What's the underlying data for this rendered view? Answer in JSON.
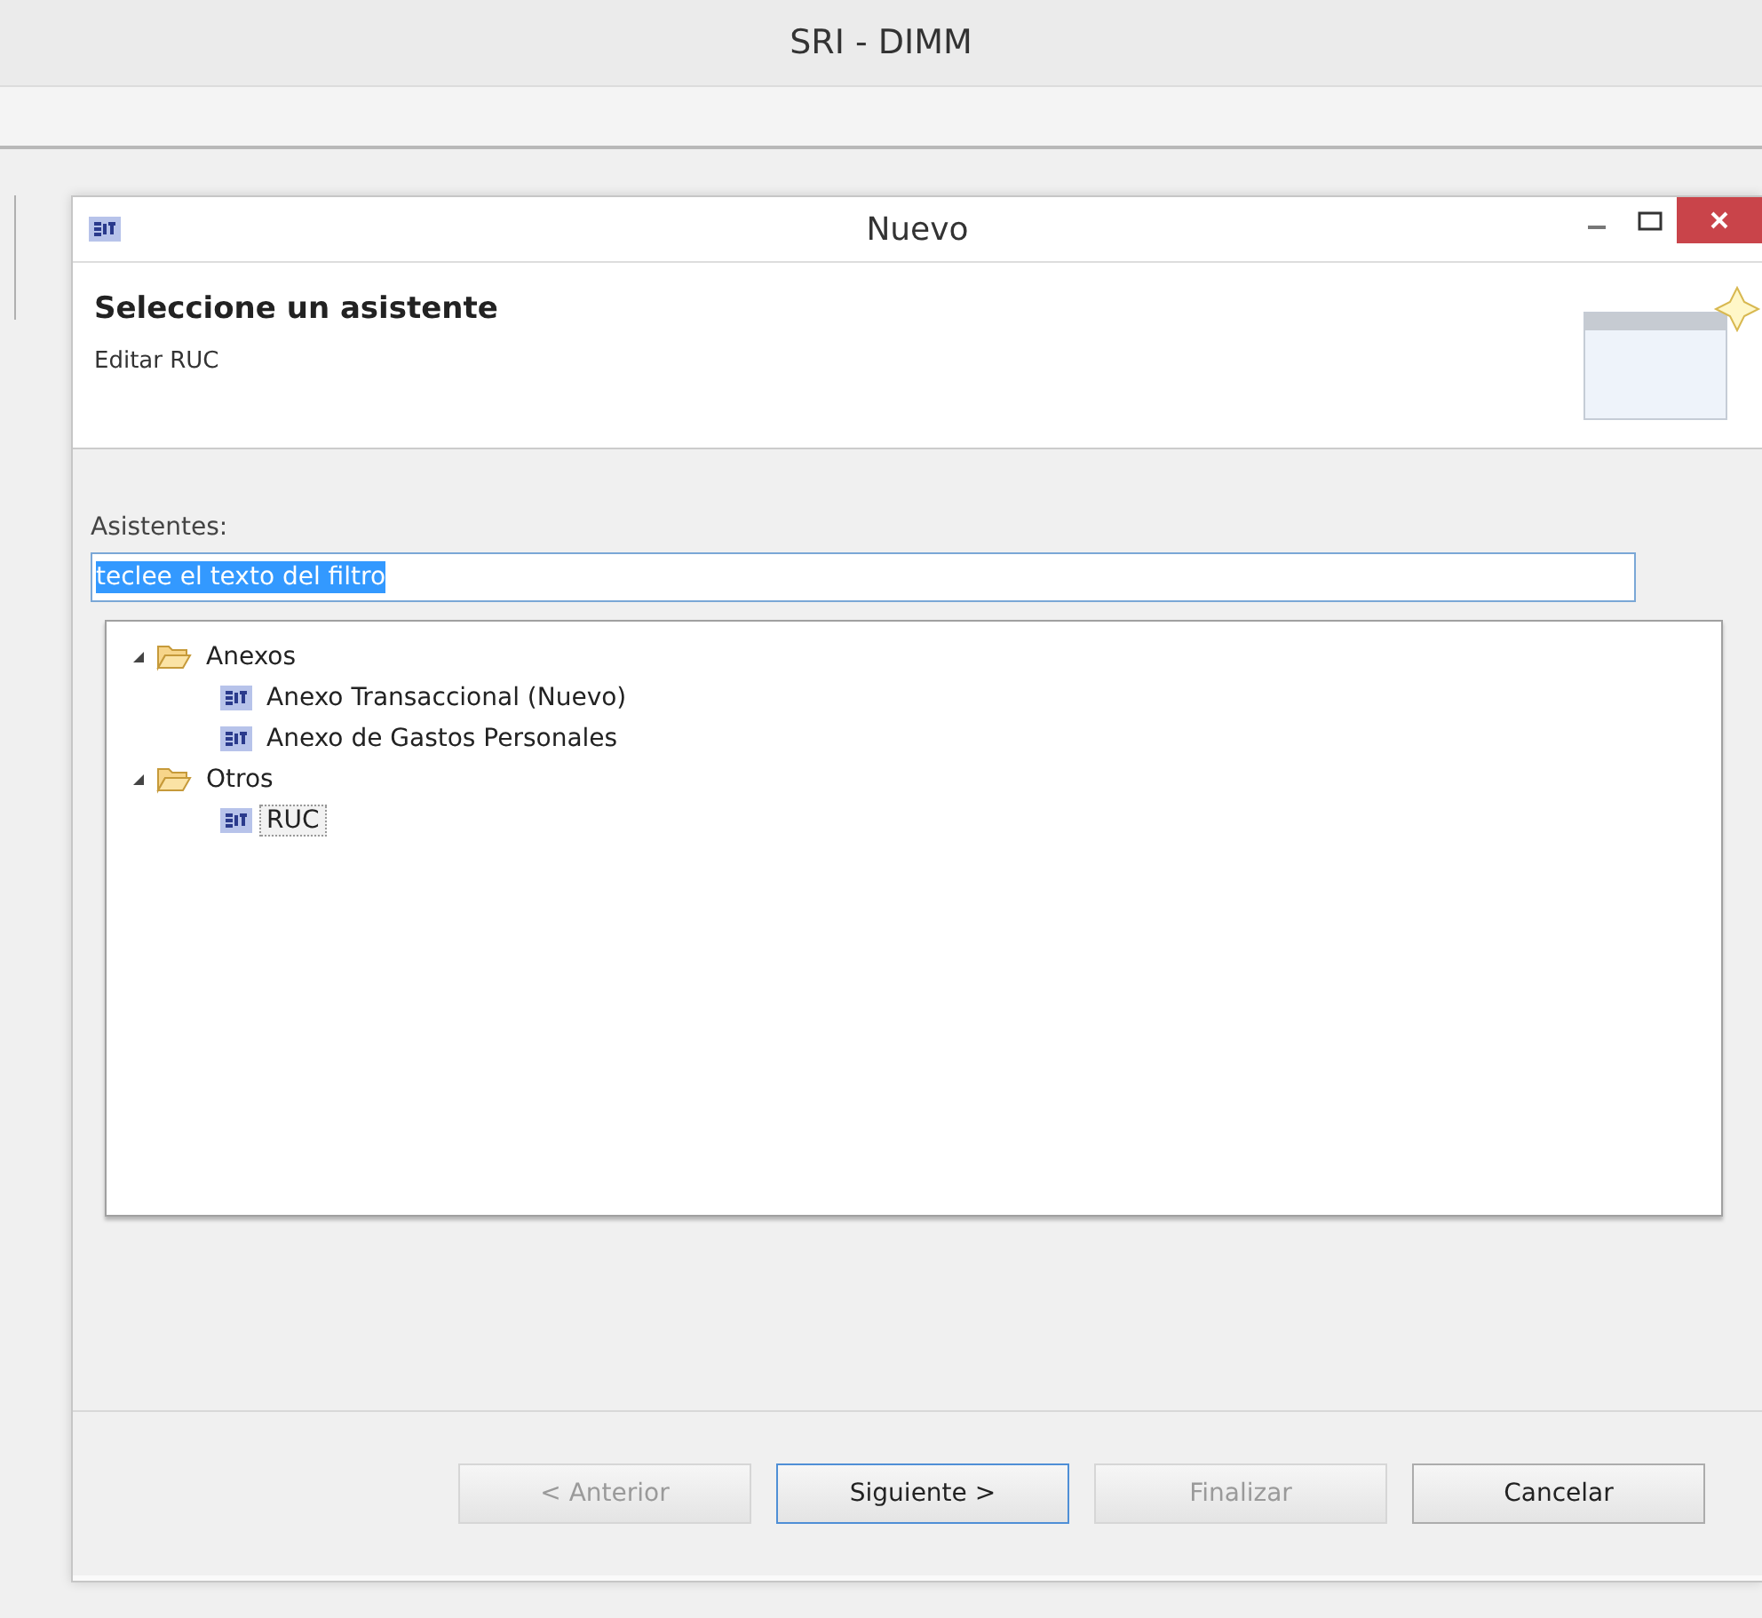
{
  "app": {
    "title": "SRI - DIMM"
  },
  "dialog": {
    "title": "Nuevo",
    "header": {
      "title": "Seleccione un asistente",
      "subtitle": "Editar RUC"
    },
    "filter": {
      "label": "Asistentes:",
      "value": "teclee el texto del filtro",
      "text_selected": true
    },
    "tree": [
      {
        "label": "Anexos",
        "kind": "folder",
        "expanded": true,
        "selected": false,
        "children": [
          {
            "label": "Anexo Transaccional (Nuevo)",
            "kind": "wizard",
            "selected": false
          },
          {
            "label": "Anexo de Gastos Personales",
            "kind": "wizard",
            "selected": false
          }
        ]
      },
      {
        "label": "Otros",
        "kind": "folder",
        "expanded": true,
        "selected": false,
        "children": [
          {
            "label": "RUC",
            "kind": "wizard",
            "selected": true
          }
        ]
      }
    ],
    "buttons": [
      {
        "label": "< Anterior",
        "disabled": true,
        "focused": false
      },
      {
        "label": "Siguiente >",
        "disabled": false,
        "focused": true
      },
      {
        "label": "Finalizar",
        "disabled": true,
        "focused": false
      },
      {
        "label": "Cancelar",
        "disabled": false,
        "focused": false
      }
    ]
  }
}
